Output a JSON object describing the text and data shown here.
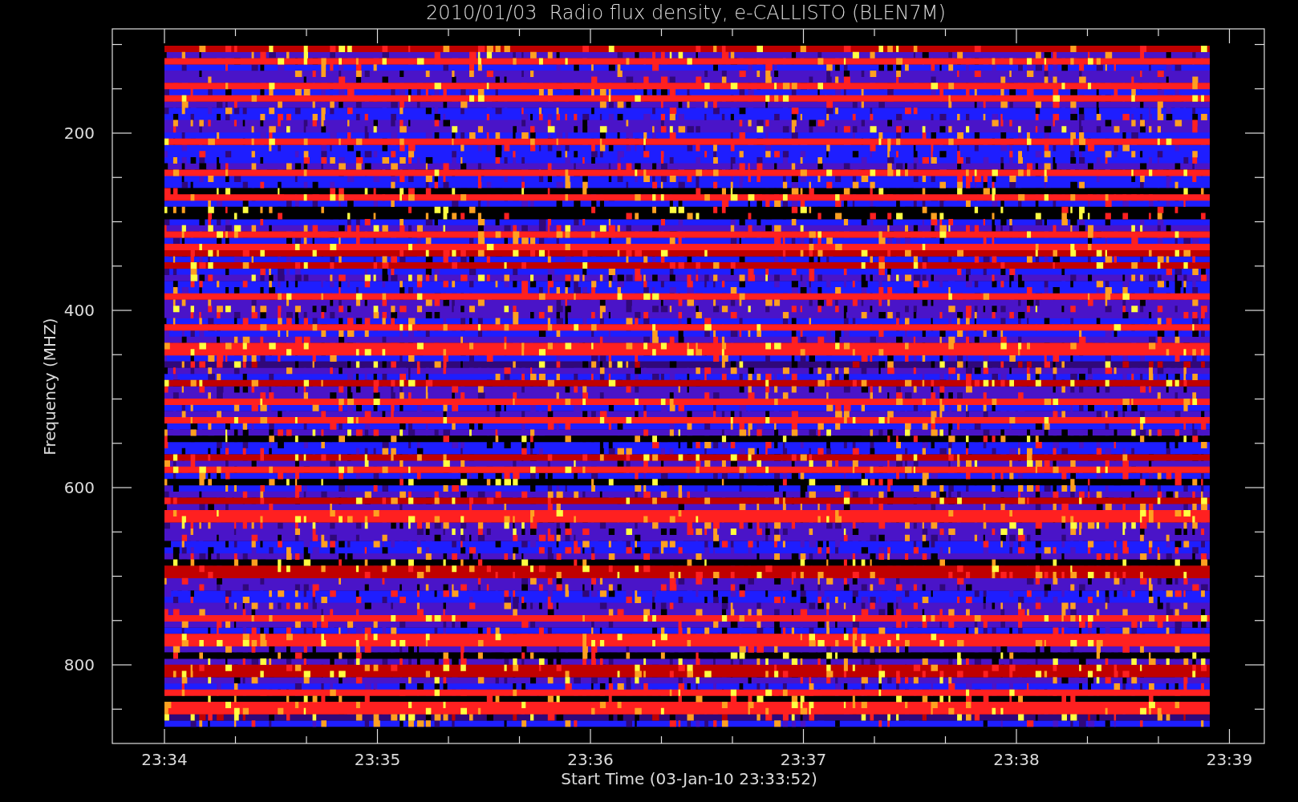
{
  "title": "2010/01/03  Radio flux density, e-CALLISTO (BLEN7M)",
  "y_axis": {
    "label": "Frequency (MHZ)",
    "ticks": [
      "200",
      "400",
      "600",
      "800"
    ]
  },
  "x_axis": {
    "label": "Start Time (03-Jan-10 23:33:52)",
    "ticks": [
      "23:34",
      "23:35",
      "23:36",
      "23:37",
      "23:38",
      "23:39"
    ]
  }
}
